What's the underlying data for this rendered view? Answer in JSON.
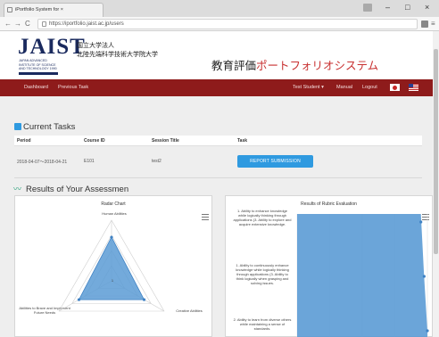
{
  "browser": {
    "tab_title": "iPortfolio System for ×",
    "tab_close": "×",
    "url": "https://iportfolio.jaist.ac.jp/users",
    "window_controls": {
      "minimize": "–",
      "maximize": "□",
      "close": "×"
    }
  },
  "header": {
    "logo_text": "JAIST",
    "logo_subtitle": "JAPAN ADVANCED INSTITUTE OF SCIENCE AND TECHNOLOGY 1990",
    "institution_line1": "国立大学法人",
    "institution_line2": "北陸先端科学技術大学院大学",
    "system_title_prefix": "教育評価",
    "system_title_accent": "ポートフォリオシステム"
  },
  "nav": {
    "dashboard": "Dashboard",
    "previous_task": "Previous Task",
    "user": "Test Student ▾",
    "manual": "Manual",
    "logout": "Logout"
  },
  "current_tasks": {
    "title": "Current Tasks",
    "columns": [
      "Period",
      "Course ID",
      "Session Title",
      "Task"
    ],
    "rows": [
      {
        "period": "2018-04-07〜2018-04-21",
        "course_id": "E101",
        "session_title": "test2",
        "task_button": "REPORT SUBMISSION"
      }
    ]
  },
  "results": {
    "title": "Results of Your Assessmen",
    "radar_panel_title": "Radar Chart",
    "radar_axes": [
      "Human Abilities",
      "Creative Abilities",
      "Abilities to Brave and Implement Future Needs"
    ],
    "radar_center_label": "1",
    "rubric_panel_title": "Results of Rubric Evaluation",
    "rubric_items": [
      "1. Ability to enhance knowledge while logically thinking through applications (3. Ability to explore and acquire extensive knowledge.",
      "1. Ability to continuously enhance knowledge while logically thinking through applications (3. Ability to think logically when grasping and solving issues.",
      "2. Ability to learn from diverse others while maintaining a sense of standards."
    ]
  },
  "chart_data": [
    {
      "type": "radar",
      "title": "Radar Chart",
      "categories": [
        "Human Abilities",
        "Creative Abilities",
        "Abilities to Brave and Implement Future Needs"
      ],
      "values": [
        0.72,
        0.62,
        0.62
      ],
      "color": "#5b9bd5"
    },
    {
      "type": "area",
      "title": "Results of Rubric Evaluation",
      "categories": [
        "1. Ability to enhance knowledge while logically thinking through applications (3. Ability to explore and acquire extensive knowledge.",
        "1. Ability to continuously enhance knowledge while logically thinking through applications (3. Ability to think logically when grasping and solving issues.",
        "2. Ability to learn from diverse others while maintaining a sense of standards."
      ],
      "values": [
        3.8,
        3.9,
        4.0
      ],
      "xlim": [
        0,
        4
      ],
      "color": "#5b9bd5"
    }
  ],
  "colors": {
    "navbar": "#8e1b1b",
    "accent_blue": "#2f9ae0",
    "title_red": "#c83030",
    "logo_navy": "#1a2a5e"
  },
  "icons": {
    "tasks_icon": "checkbox-icon",
    "results_icon": "trend-icon",
    "panel_menu": "hamburger-icon"
  }
}
